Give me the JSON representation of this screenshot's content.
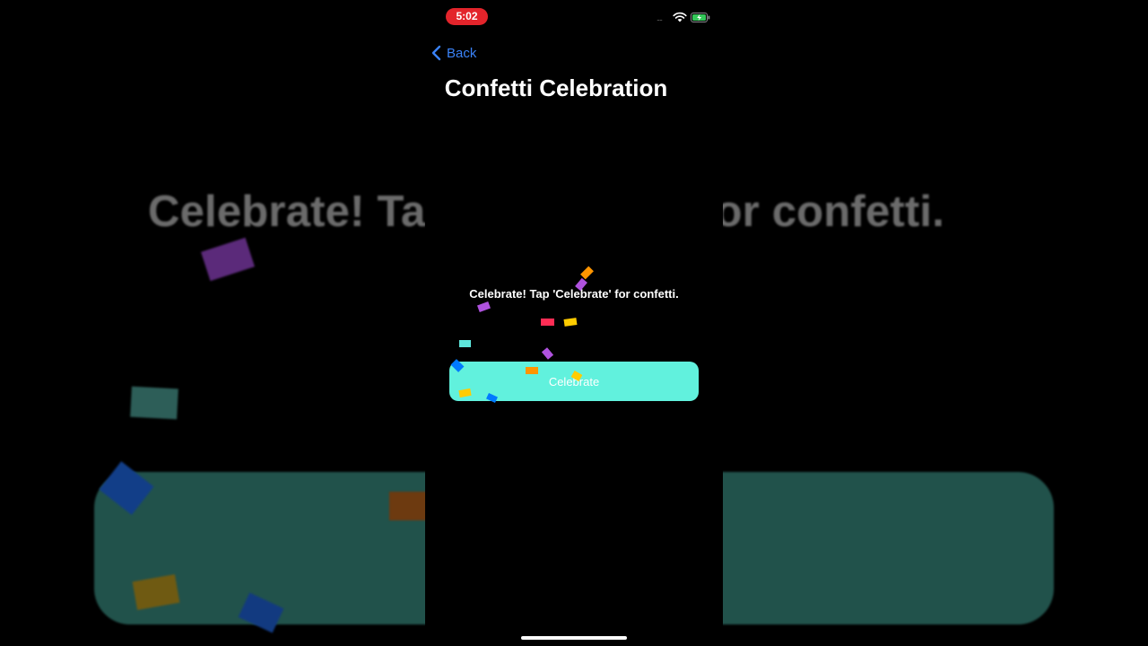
{
  "status_bar": {
    "time": "5:02",
    "signal_dots": "....",
    "wifi_icon": "wifi-icon",
    "battery_icon": "battery-charging-icon",
    "colors": {
      "time_pill": "#e3242b",
      "battery": "#34c759"
    }
  },
  "navigation": {
    "back_label": "Back",
    "back_icon": "chevron-left-icon",
    "title": "Confetti Celebration"
  },
  "main": {
    "message": "Celebrate! Tap 'Celebrate' for confetti.",
    "button_label": "Celebrate"
  },
  "background_echo": {
    "text": "Celebrate! Tap 'Celebrate' for confetti."
  },
  "colors": {
    "accent": "#3a82f7",
    "button": "#61f1dd",
    "confetti": [
      "#ff9500",
      "#af52de",
      "#ff2d55",
      "#ffcc00",
      "#5ee7dc",
      "#007aff"
    ]
  }
}
